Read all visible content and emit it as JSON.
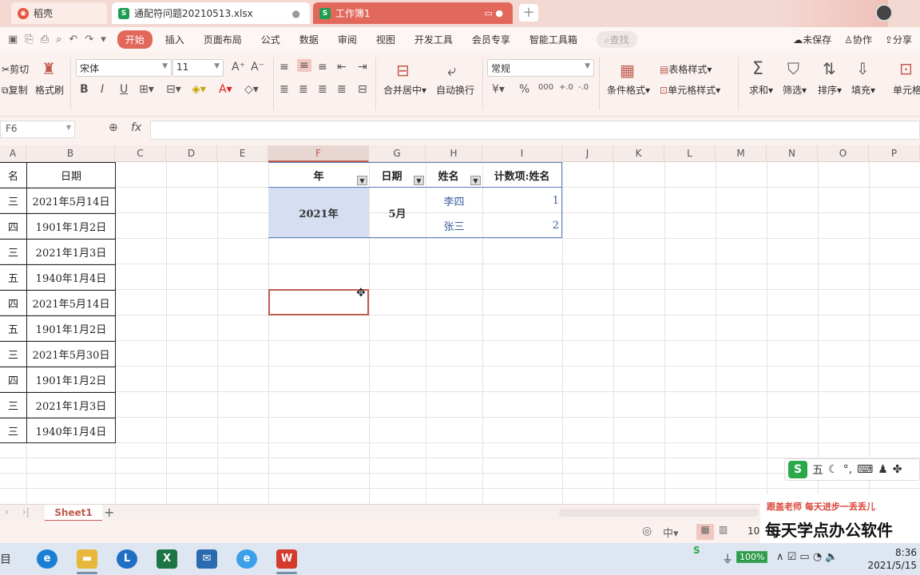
{
  "titlebar": {
    "tabs": [
      {
        "label": "稻壳"
      },
      {
        "label": "通配符问题20210513.xlsx"
      },
      {
        "label": "工作簿1"
      }
    ]
  },
  "menu": {
    "items": [
      "开始",
      "插入",
      "页面布局",
      "公式",
      "数据",
      "审阅",
      "视图",
      "开发工具",
      "会员专享",
      "智能工具箱"
    ],
    "search": "查找",
    "right": [
      "未保存",
      "协作",
      "分享"
    ]
  },
  "ribbon": {
    "cut": "剪切",
    "copy": "复制",
    "format_painter": "格式刷",
    "font_name": "宋体",
    "font_size": "11",
    "merge_center": "合并居中",
    "wrap": "自动换行",
    "number_format": "常规",
    "table_style": "表格样式",
    "cond_format": "条件格式",
    "cell_style": "单元格样式",
    "sum": "求和",
    "filter": "筛选",
    "sort": "排序",
    "fill": "填充",
    "cell": "单元格"
  },
  "formula_bar": {
    "name_box": "F6",
    "fx": "fx",
    "value": ""
  },
  "columns": [
    "A",
    "B",
    "C",
    "D",
    "E",
    "F",
    "G",
    "H",
    "I",
    "J",
    "K",
    "L",
    "M",
    "N",
    "O",
    "P"
  ],
  "table": {
    "header_a": "名",
    "header_b": "日期",
    "col_a": [
      "三",
      "四",
      "三",
      "五",
      "四",
      "五",
      "三",
      "四",
      "三",
      "三"
    ],
    "col_b": [
      "2021年5月14日",
      "1901年1月2日",
      "2021年1月3日",
      "1940年1月4日",
      "2021年5月14日",
      "1901年1月2日",
      "2021年5月30日",
      "1901年1月2日",
      "2021年1月3日",
      "1940年1月4日"
    ]
  },
  "pivot": {
    "headers": [
      "年",
      "日期",
      "姓名",
      "计数项:姓名"
    ],
    "year": "2021年",
    "month": "5月",
    "names": [
      "李四",
      "张三"
    ],
    "counts": [
      "1",
      "2"
    ]
  },
  "sheet": {
    "tab": "Sheet1",
    "add": "+"
  },
  "status": {
    "zoom": "10"
  },
  "ime": {
    "mode": "五"
  },
  "watermark": {
    "line1": "跟盖老师  每天进步一丢丢儿",
    "line2": "每天学点办公软件"
  },
  "taskbar": {
    "battery": "100%",
    "time": "8:36",
    "date": "2021/5/15"
  },
  "colors": {
    "accent": "#e2685b",
    "selection": "#c05b4f",
    "pivot_fill": "#d6dff2",
    "name_text": "#3b5ea0"
  }
}
